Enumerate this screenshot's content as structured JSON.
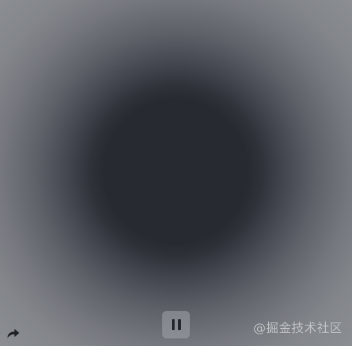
{
  "colors": {
    "center": "#272a31",
    "edge": "#8d9095",
    "button_bg": "#a0a4aa",
    "icon": "#23262c"
  },
  "controls": {
    "pause_icon": "pause-icon",
    "share_icon": "share-arrow-icon"
  },
  "watermark": {
    "text": "@掘金技术社区"
  }
}
